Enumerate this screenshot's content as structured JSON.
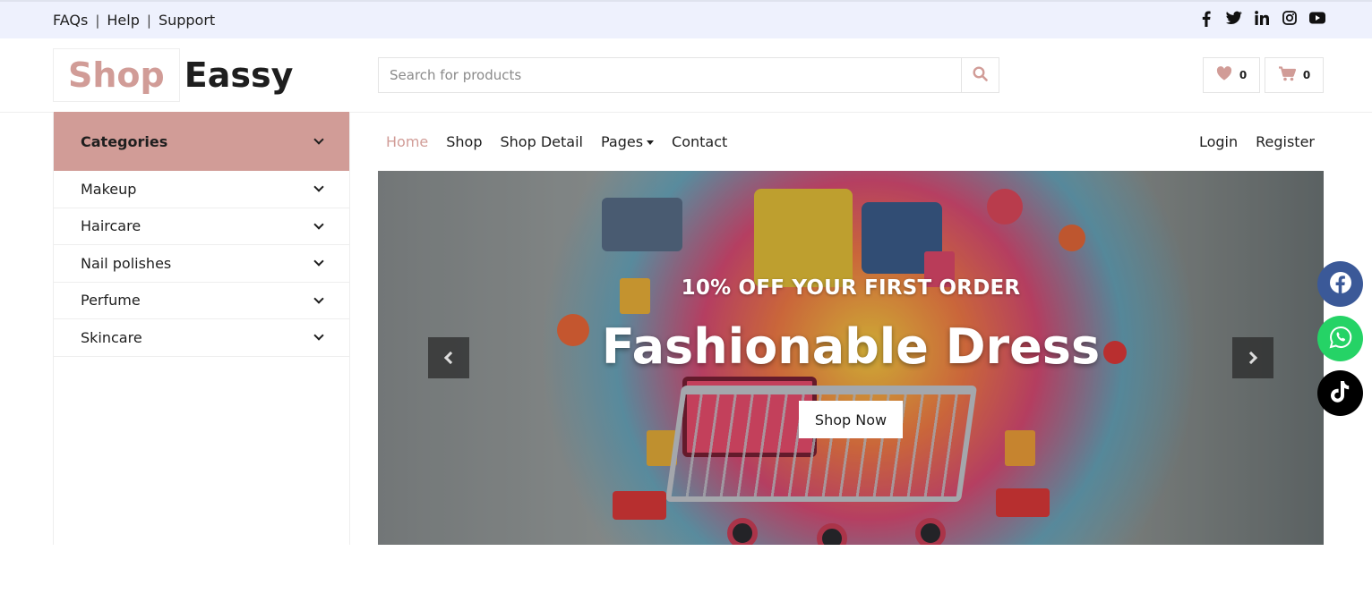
{
  "topbar": {
    "links": [
      "FAQs",
      "Help",
      "Support"
    ],
    "separator": "|",
    "social_icons": [
      "facebook-icon",
      "twitter-icon",
      "linkedin-icon",
      "instagram-icon",
      "youtube-icon"
    ]
  },
  "header": {
    "logo_part1": "Shop",
    "logo_part2": "Eassy",
    "search_placeholder": "Search for products",
    "wishlist_count": "0",
    "cart_count": "0"
  },
  "categories": {
    "title": "Categories",
    "items": [
      {
        "label": "Makeup"
      },
      {
        "label": "Haircare"
      },
      {
        "label": "Nail polishes"
      },
      {
        "label": "Perfume"
      },
      {
        "label": "Skincare"
      }
    ]
  },
  "nav": {
    "items": [
      {
        "label": "Home",
        "active": true
      },
      {
        "label": "Shop"
      },
      {
        "label": "Shop Detail"
      },
      {
        "label": "Pages"
      },
      {
        "label": "Contact"
      }
    ],
    "login": "Login",
    "register": "Register"
  },
  "hero": {
    "subtitle": "10% OFF YOUR FIRST ORDER",
    "title": "Fashionable Dress",
    "button": "Shop Now"
  },
  "floating_social": [
    "facebook-icon",
    "whatsapp-icon",
    "tiktok-icon"
  ],
  "colors": {
    "accent": "#d19c97",
    "topbar_bg": "#eef1fd",
    "text": "#1e1e1e",
    "facebook": "#3b5998",
    "whatsapp": "#25d366",
    "tiktok": "#000000"
  }
}
